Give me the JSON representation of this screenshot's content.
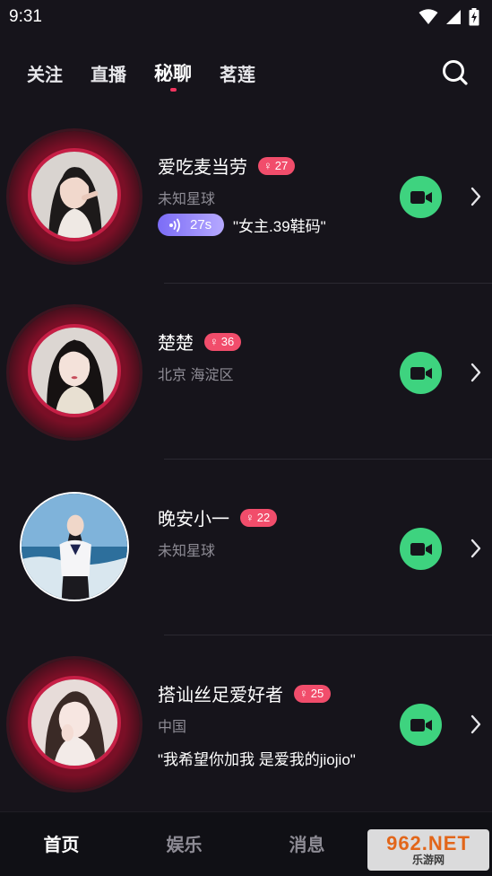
{
  "status_bar": {
    "time": "9:31"
  },
  "top_tabs": [
    {
      "label": "关注",
      "active": false
    },
    {
      "label": "直播",
      "active": false
    },
    {
      "label": "秘聊",
      "active": true
    },
    {
      "label": "茗莲",
      "active": false
    }
  ],
  "users": [
    {
      "name": "爱吃麦当劳",
      "badge": "27",
      "location": "未知星球",
      "voice_duration": "27s",
      "voice_text": "\"女主.39鞋码\""
    },
    {
      "name": "楚楚",
      "badge": "36",
      "location": "北京 海淀区"
    },
    {
      "name": "晚安小一",
      "badge": "22",
      "location": "未知星球"
    },
    {
      "name": "搭讪丝足爱好者",
      "badge": "25",
      "location": "中国",
      "quote": "\"我希望你加我 是爱我的jiojio\""
    }
  ],
  "bottom_nav": [
    {
      "label": "首页",
      "active": true
    },
    {
      "label": "娱乐",
      "active": false
    },
    {
      "label": "消息",
      "active": false
    }
  ],
  "watermark": {
    "main": "962.NET",
    "sub": "乐游网"
  },
  "colors": {
    "accent": "#f0355f",
    "badge": "#f14d6b",
    "call": "#3ed37f",
    "voice": "#7b6cf6",
    "background": "#16141b"
  }
}
